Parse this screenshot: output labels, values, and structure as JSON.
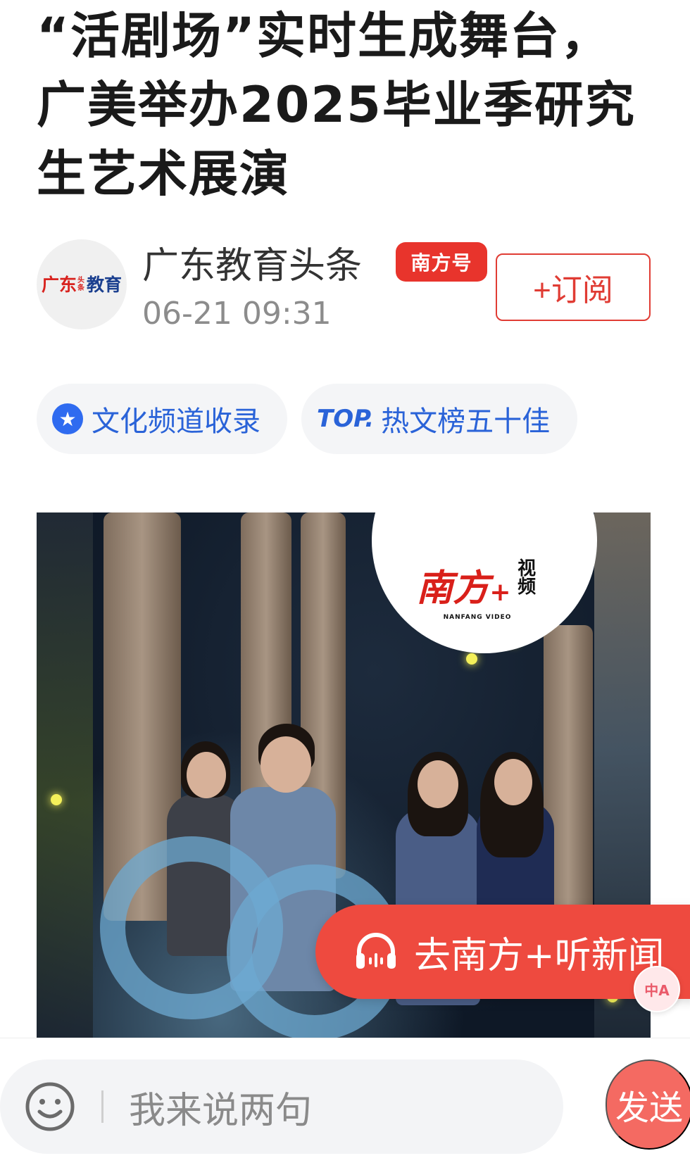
{
  "article": {
    "title": "“活剧场”实时生成舞台，广美举办2025毕业季研究生艺术展演"
  },
  "author": {
    "avatar_logo": {
      "part1": "广东",
      "part2": "头条",
      "part3": "教育"
    },
    "name": "广东教育头条",
    "badge": "南方号",
    "time": "06-21 09:31",
    "subscribe_label": "+订阅"
  },
  "tags": [
    {
      "icon": "star-icon",
      "label": "文化频道收录"
    },
    {
      "mark": "TOP.",
      "label": "热文榜五十佳"
    }
  ],
  "media": {
    "watermark": {
      "main": "南方",
      "plus": "+",
      "sub": "视频",
      "en": "NANFANG VIDEO"
    }
  },
  "listen_button": {
    "label": "去南方+听新闻",
    "icon": "headphone-icon",
    "color": "#ee4a3f"
  },
  "translate_fab": {
    "icon": "translate-icon",
    "glyph": "中A"
  },
  "comment_bar": {
    "placeholder": "我来说两句",
    "send_label": "发送",
    "emoji_icon": "smile-icon"
  },
  "colors": {
    "accent_red": "#e03c34",
    "link_blue": "#2a63d8"
  }
}
